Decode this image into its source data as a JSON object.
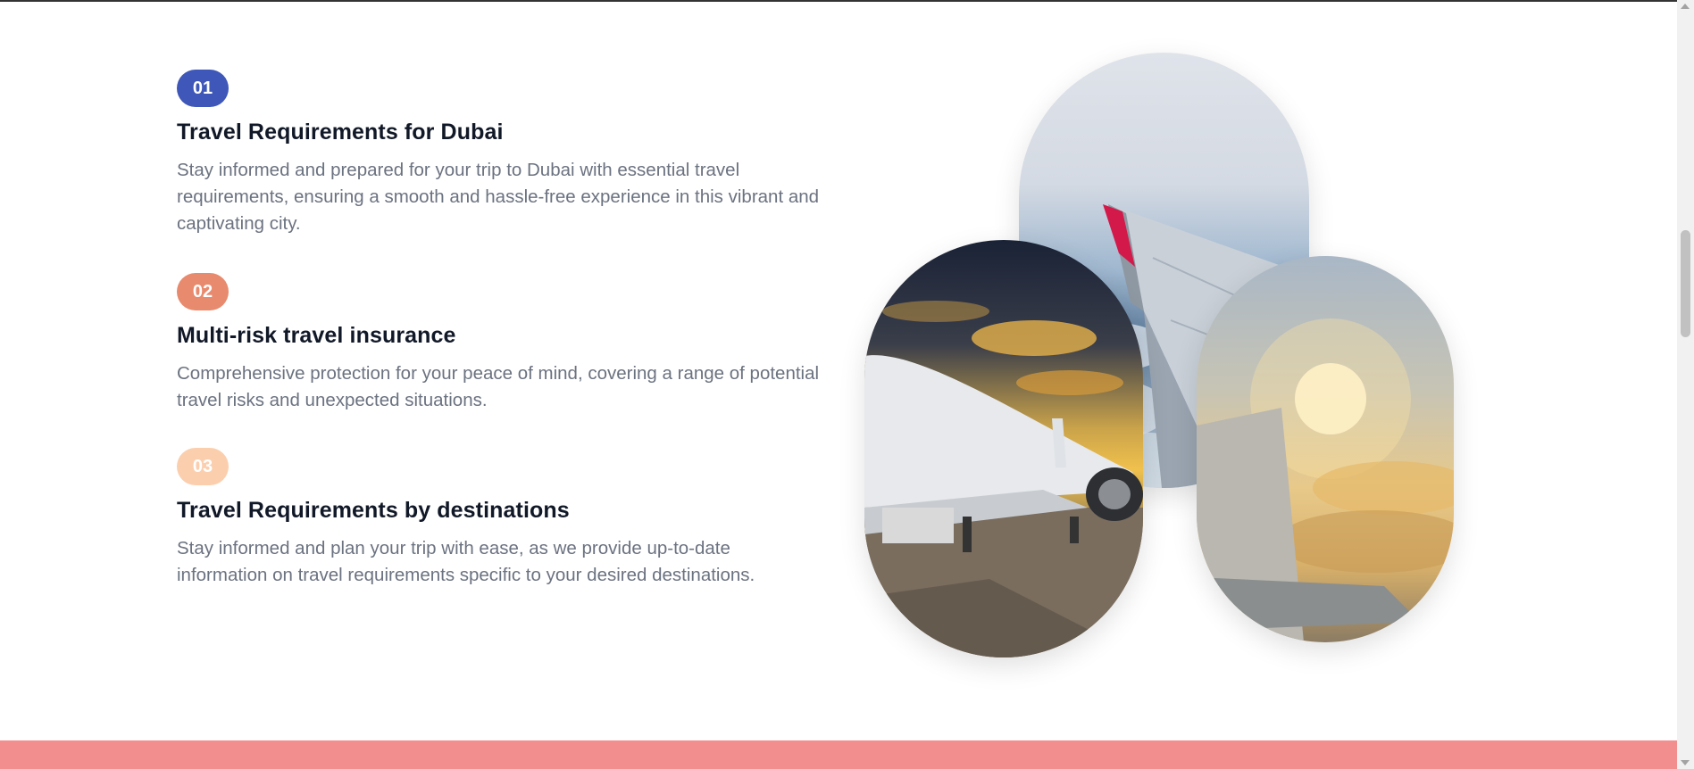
{
  "features": [
    {
      "number": "01",
      "title": "Travel Requirements for Dubai",
      "description": "Stay informed and prepared for your trip to Dubai with essential travel requirements, ensuring a smooth and hassle-free experience in this vibrant and captivating city."
    },
    {
      "number": "02",
      "title": "Multi-risk travel insurance",
      "description": "Comprehensive protection for your peace of mind, covering a range of potential travel risks and unexpected situations."
    },
    {
      "number": "03",
      "title": "Travel Requirements by destinations",
      "description": "Stay informed and plan your trip with ease, as we provide up-to-date information on travel requirements specific to your desired destinations."
    }
  ],
  "colors": {
    "badge_1": "#3e57b8",
    "badge_2": "#e88a6d",
    "badge_3": "#fbcfae",
    "bottom_band": "#f28e8e"
  }
}
